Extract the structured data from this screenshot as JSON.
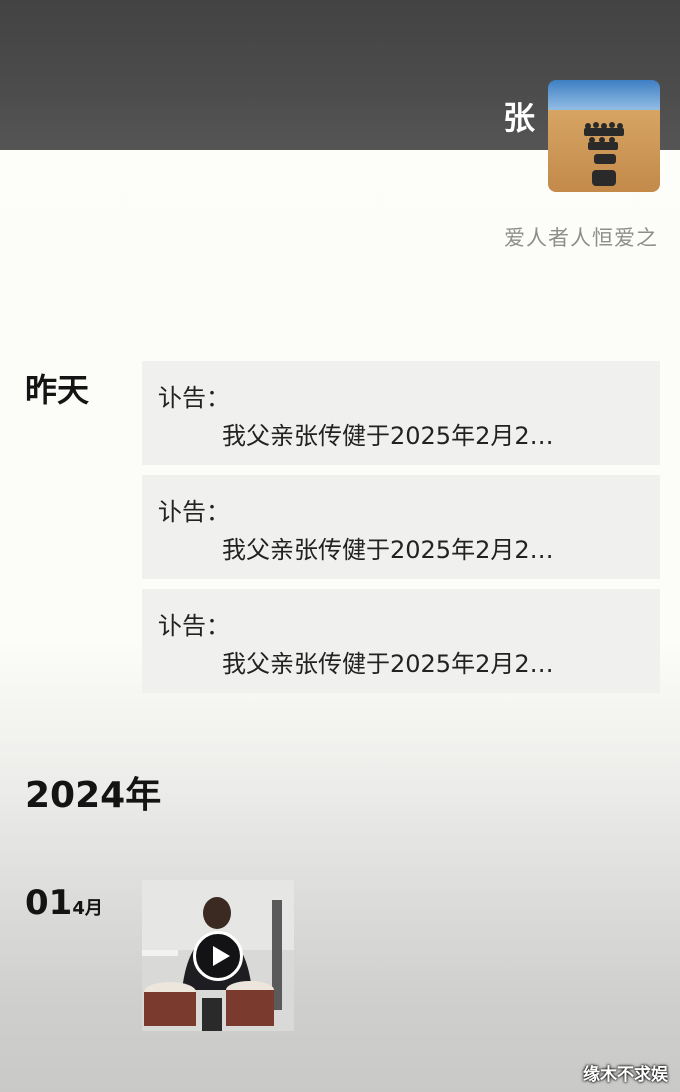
{
  "profile": {
    "name": "张",
    "signature": "爱人者人恒爱之"
  },
  "sections": [
    {
      "date": "昨天",
      "posts": [
        {
          "title": "讣告：",
          "body": "我父亲张传健于2025年2月2…"
        },
        {
          "title": "讣告：",
          "body": "我父亲张传健于2025年2月2…"
        },
        {
          "title": "讣告：",
          "body": "我父亲张传健于2025年2月2…"
        }
      ]
    }
  ],
  "year_section": {
    "year": "2024年",
    "day": "01",
    "month": "4月"
  },
  "watermark": "缘木不求娱",
  "colors": {
    "card_bg": "#f0f0ee",
    "signature": "#8e8e8e",
    "cover": "#4a4a4a"
  }
}
